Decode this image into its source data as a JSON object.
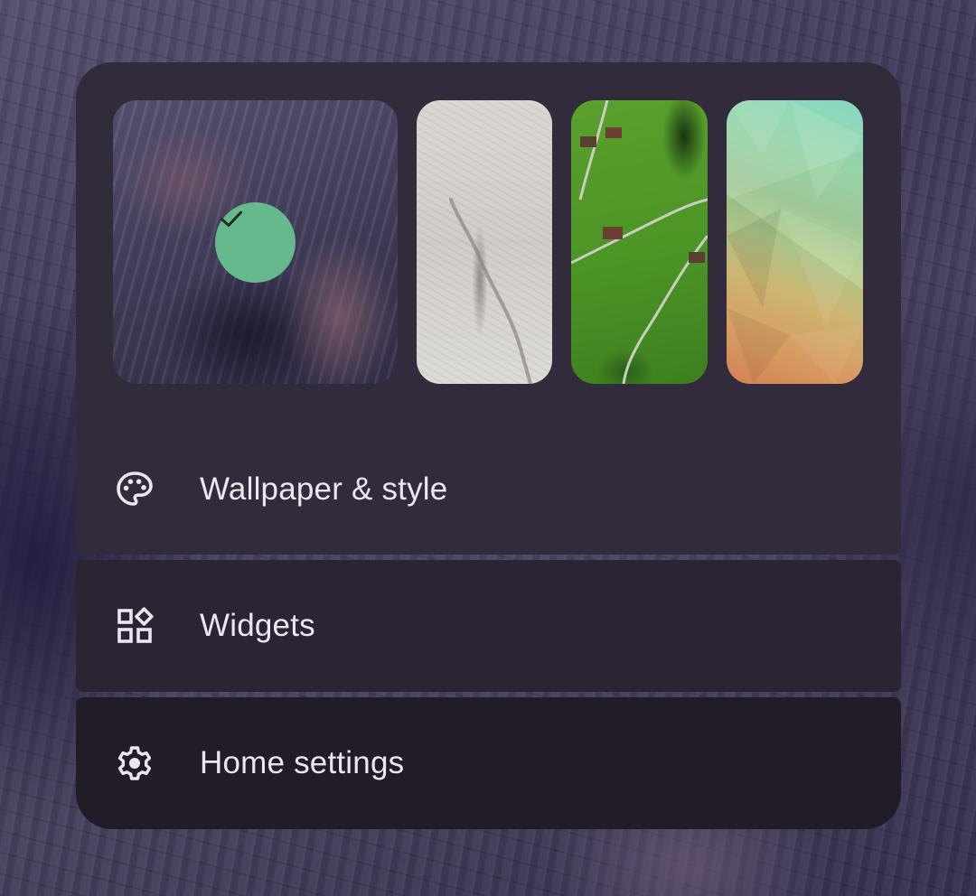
{
  "wallpaper_picker": {
    "thumbnails": [
      {
        "name": "current-wallpaper-cliffs",
        "selected": true
      },
      {
        "name": "wallpaper-sand",
        "selected": false
      },
      {
        "name": "wallpaper-green-hills",
        "selected": false
      },
      {
        "name": "wallpaper-gradient-polygons",
        "selected": false
      }
    ],
    "selected_icon": "check-icon",
    "selected_color": "#66b98c"
  },
  "menu": {
    "wallpaper_style": {
      "label": "Wallpaper & style",
      "icon": "palette-icon"
    },
    "widgets": {
      "label": "Widgets",
      "icon": "widgets-icon"
    },
    "home_settings": {
      "label": "Home settings",
      "icon": "gear-icon"
    }
  },
  "colors": {
    "panel_top": "#322b3c",
    "panel_middle": "#2a2433",
    "panel_bottom": "#211c28",
    "text": "#ece6f0"
  }
}
